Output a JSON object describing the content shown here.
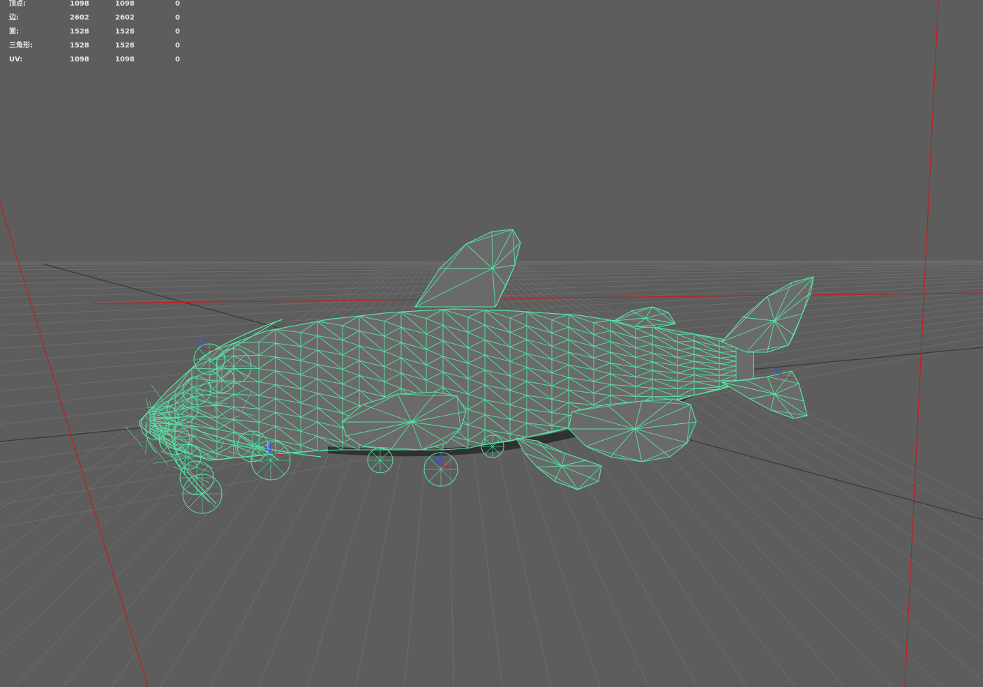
{
  "hud": {
    "rows": [
      {
        "label": "顶点:",
        "c1": "1098",
        "c2": "1098",
        "c3": "0"
      },
      {
        "label": "边:",
        "c1": "2602",
        "c2": "2602",
        "c3": "0"
      },
      {
        "label": "面:",
        "c1": "1528",
        "c2": "1528",
        "c3": "0"
      },
      {
        "label": "三角形:",
        "c1": "1528",
        "c2": "1528",
        "c3": "0"
      },
      {
        "label": "UV:",
        "c1": "1098",
        "c2": "1098",
        "c3": "0"
      }
    ]
  },
  "colors": {
    "background": "#5d5d5d",
    "grid": "#6c6c6c",
    "grid_axis": "#3c3c3c",
    "camera_line": "#c01e1e",
    "wireframe": "#55e7a6",
    "mesh_fill": "#6a6a6a"
  },
  "icons": {
    "pivot": "transform-pivot-icon"
  }
}
